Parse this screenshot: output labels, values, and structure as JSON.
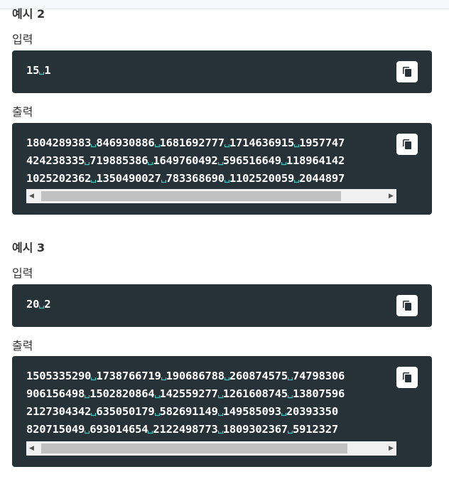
{
  "examples": [
    {
      "title": "예시 2",
      "input_label": "입력",
      "input_lines": [
        [
          "15",
          "1"
        ]
      ],
      "output_label": "출력",
      "output_lines": [
        [
          "1804289383",
          "846930886",
          "1681692777",
          "1714636915",
          "1957747"
        ],
        [
          "424238335",
          "719885386",
          "1649760492",
          "596516649",
          "118964142"
        ],
        [
          "1025202362",
          "1350490027",
          "783368690",
          "1102520059",
          "2044897"
        ]
      ],
      "output_scroll_fraction": 0.88
    },
    {
      "title": "예시 3",
      "input_label": "입력",
      "input_lines": [
        [
          "20",
          "2"
        ]
      ],
      "output_label": "출력",
      "output_lines": [
        [
          "1505335290",
          "1738766719",
          "190686788",
          "260874575",
          "74798306"
        ],
        [
          "906156498",
          "1502820864",
          "142559277",
          "1261608745",
          "13807596"
        ],
        [
          "2127304342",
          "635050179",
          "582691149",
          "149585093",
          "20393350"
        ],
        [
          "820715049",
          "693014654",
          "2122498773",
          "1809302367",
          "5912327"
        ]
      ],
      "output_scroll_fraction": 0.9
    }
  ],
  "icons": {
    "copy": "copy-icon",
    "scroll_left": "scroll-left-arrow-icon",
    "scroll_right": "scroll-right-arrow-icon"
  },
  "colors": {
    "code_bg": "#263238",
    "space_marker": "#3fc8c0",
    "code_text": "#ffffff"
  }
}
